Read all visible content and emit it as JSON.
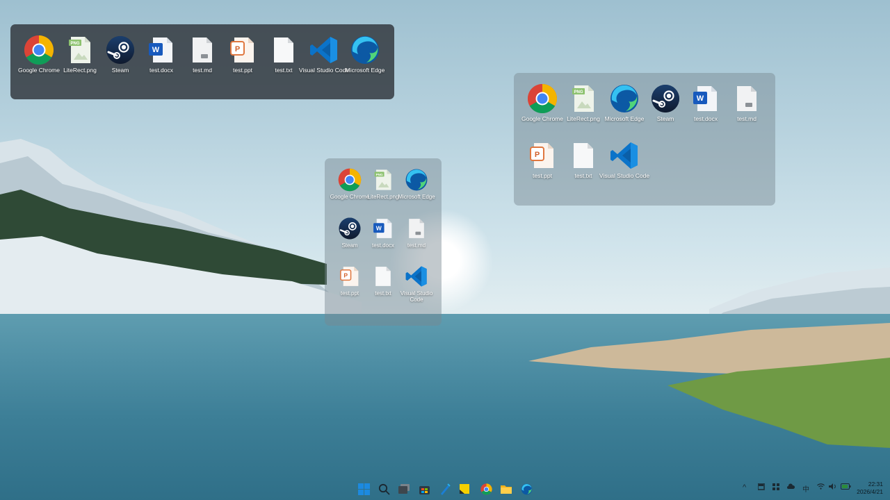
{
  "panel_top": {
    "icons": [
      {
        "label": "Google Chrome",
        "icon": "chrome-icon"
      },
      {
        "label": "LiteRect.png",
        "icon": "png-file-icon"
      },
      {
        "label": "Steam",
        "icon": "steam-icon"
      },
      {
        "label": "test.docx",
        "icon": "word-icon"
      },
      {
        "label": "test.md",
        "icon": "md-file-icon"
      },
      {
        "label": "test.ppt",
        "icon": "powerpoint-icon"
      },
      {
        "label": "test.txt",
        "icon": "txt-file-icon"
      },
      {
        "label": "Visual Studio Code",
        "icon": "vscode-icon"
      },
      {
        "label": "Microsoft Edge",
        "icon": "edge-icon"
      }
    ]
  },
  "panel_right": {
    "icons": [
      {
        "label": "Google Chrome",
        "icon": "chrome-icon"
      },
      {
        "label": "LiteRect.png",
        "icon": "png-file-icon"
      },
      {
        "label": "Microsoft Edge",
        "icon": "edge-icon"
      },
      {
        "label": "Steam",
        "icon": "steam-icon"
      },
      {
        "label": "test.docx",
        "icon": "word-icon"
      },
      {
        "label": "test.md",
        "icon": "md-file-icon"
      },
      {
        "label": "test.ppt",
        "icon": "powerpoint-icon"
      },
      {
        "label": "test.txt",
        "icon": "txt-file-icon"
      },
      {
        "label": "Visual Studio Code",
        "icon": "vscode-icon"
      }
    ]
  },
  "panel_center": {
    "icons": [
      {
        "label": "Google Chrome",
        "icon": "chrome-icon"
      },
      {
        "label": "LiteRect.png",
        "icon": "png-file-icon"
      },
      {
        "label": "Microsoft Edge",
        "icon": "edge-icon"
      },
      {
        "label": "Steam",
        "icon": "steam-icon"
      },
      {
        "label": "test.docx",
        "icon": "word-icon"
      },
      {
        "label": "test.md",
        "icon": "md-file-icon"
      },
      {
        "label": "test.ppt",
        "icon": "powerpoint-icon"
      },
      {
        "label": "test.txt",
        "icon": "txt-file-icon"
      },
      {
        "label": "Visual Studio Code",
        "icon": "vscode-icon"
      }
    ]
  },
  "taskbar": {
    "apps": [
      "start-icon",
      "search-icon",
      "task-view-icon",
      "store-icon",
      "pen-icon",
      "sticky-notes-icon",
      "chrome-icon",
      "file-explorer-icon",
      "edge-icon"
    ],
    "tray": {
      "chevron": "^",
      "ime": "中",
      "time": "22:31",
      "date": "2026/4/21"
    }
  },
  "colors": {
    "accent": "#0078d4",
    "panel_dark": "#30343a",
    "panel_light": "#7a8791"
  }
}
